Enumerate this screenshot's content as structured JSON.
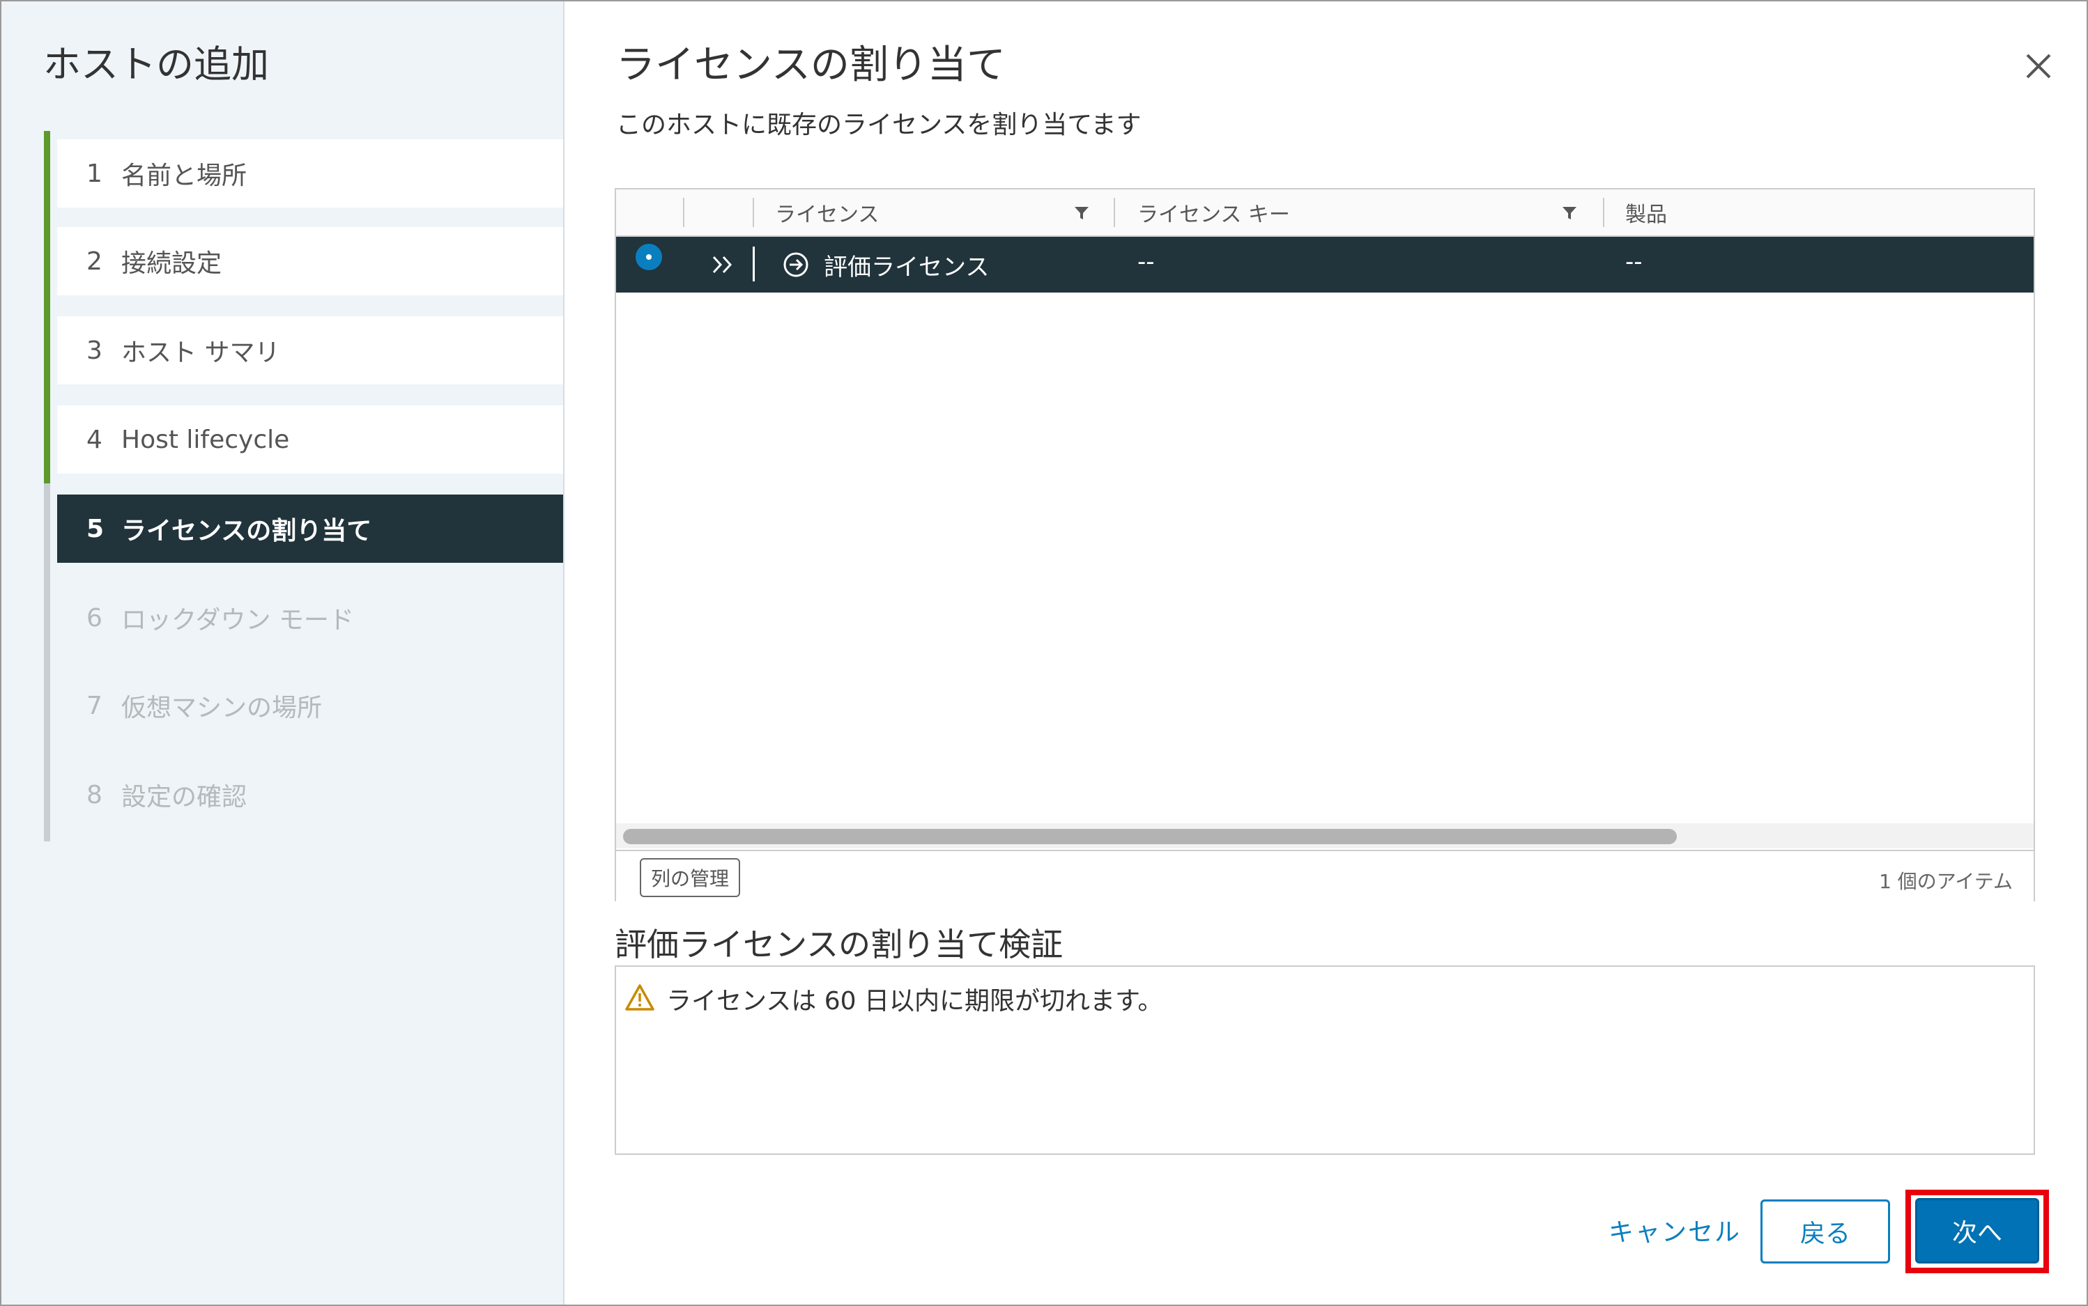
{
  "wizard": {
    "title": "ホストの追加",
    "steps": [
      {
        "num": "1",
        "label": "名前と場所",
        "state": "done"
      },
      {
        "num": "2",
        "label": "接続設定",
        "state": "done"
      },
      {
        "num": "3",
        "label": "ホスト サマリ",
        "state": "done"
      },
      {
        "num": "4",
        "label": "Host lifecycle",
        "state": "done"
      },
      {
        "num": "5",
        "label": "ライセンスの割り当て",
        "state": "current"
      },
      {
        "num": "6",
        "label": "ロックダウン モード",
        "state": "todo"
      },
      {
        "num": "7",
        "label": "仮想マシンの場所",
        "state": "todo"
      },
      {
        "num": "8",
        "label": "設定の確認",
        "state": "todo"
      }
    ]
  },
  "page": {
    "title": "ライセンスの割り当て",
    "subtitle": "このホストに既存のライセンスを割り当てます"
  },
  "grid": {
    "columns": {
      "license": "ライセンス",
      "license_key": "ライセンス キー",
      "product": "製品"
    },
    "rows": [
      {
        "license": "評価ライセンス",
        "license_key": "--",
        "product": "--",
        "selected": true
      }
    ],
    "manage_columns_label": "列の管理",
    "item_count": "1 個のアイテム"
  },
  "validation": {
    "title": "評価ライセンスの割り当て検証",
    "message": "ライセンスは 60 日以内に期限が切れます。"
  },
  "footer": {
    "cancel_label": "キャンセル",
    "back_label": "戻る",
    "next_label": "次へ"
  },
  "colors": {
    "accent": "#0072b5",
    "selected_row": "#21333b",
    "completed_step": "#5c9a2c",
    "highlight": "#e8000e",
    "warning": "#c98a00"
  },
  "icons": {
    "close": "close-icon",
    "filter": "filter-icon",
    "expand": "double-chevron-right-icon",
    "detail": "arrow-circle-right-icon",
    "warning": "warning-triangle-icon"
  }
}
